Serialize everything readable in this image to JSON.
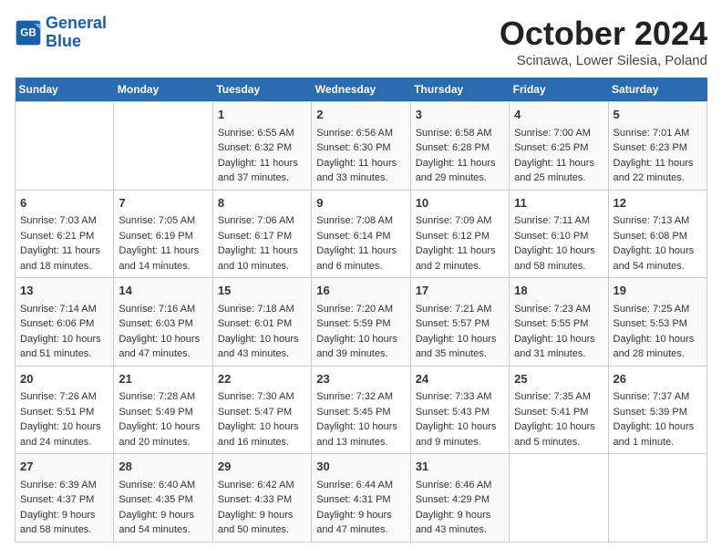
{
  "header": {
    "logo_line1": "General",
    "logo_line2": "Blue",
    "month": "October 2024",
    "location": "Scinawa, Lower Silesia, Poland"
  },
  "days_of_week": [
    "Sunday",
    "Monday",
    "Tuesday",
    "Wednesday",
    "Thursday",
    "Friday",
    "Saturday"
  ],
  "weeks": [
    [
      {
        "day": "",
        "info": ""
      },
      {
        "day": "",
        "info": ""
      },
      {
        "day": "1",
        "info": "Sunrise: 6:55 AM\nSunset: 6:32 PM\nDaylight: 11 hours and 37 minutes."
      },
      {
        "day": "2",
        "info": "Sunrise: 6:56 AM\nSunset: 6:30 PM\nDaylight: 11 hours and 33 minutes."
      },
      {
        "day": "3",
        "info": "Sunrise: 6:58 AM\nSunset: 6:28 PM\nDaylight: 11 hours and 29 minutes."
      },
      {
        "day": "4",
        "info": "Sunrise: 7:00 AM\nSunset: 6:25 PM\nDaylight: 11 hours and 25 minutes."
      },
      {
        "day": "5",
        "info": "Sunrise: 7:01 AM\nSunset: 6:23 PM\nDaylight: 11 hours and 22 minutes."
      }
    ],
    [
      {
        "day": "6",
        "info": "Sunrise: 7:03 AM\nSunset: 6:21 PM\nDaylight: 11 hours and 18 minutes."
      },
      {
        "day": "7",
        "info": "Sunrise: 7:05 AM\nSunset: 6:19 PM\nDaylight: 11 hours and 14 minutes."
      },
      {
        "day": "8",
        "info": "Sunrise: 7:06 AM\nSunset: 6:17 PM\nDaylight: 11 hours and 10 minutes."
      },
      {
        "day": "9",
        "info": "Sunrise: 7:08 AM\nSunset: 6:14 PM\nDaylight: 11 hours and 6 minutes."
      },
      {
        "day": "10",
        "info": "Sunrise: 7:09 AM\nSunset: 6:12 PM\nDaylight: 11 hours and 2 minutes."
      },
      {
        "day": "11",
        "info": "Sunrise: 7:11 AM\nSunset: 6:10 PM\nDaylight: 10 hours and 58 minutes."
      },
      {
        "day": "12",
        "info": "Sunrise: 7:13 AM\nSunset: 6:08 PM\nDaylight: 10 hours and 54 minutes."
      }
    ],
    [
      {
        "day": "13",
        "info": "Sunrise: 7:14 AM\nSunset: 6:06 PM\nDaylight: 10 hours and 51 minutes."
      },
      {
        "day": "14",
        "info": "Sunrise: 7:16 AM\nSunset: 6:03 PM\nDaylight: 10 hours and 47 minutes."
      },
      {
        "day": "15",
        "info": "Sunrise: 7:18 AM\nSunset: 6:01 PM\nDaylight: 10 hours and 43 minutes."
      },
      {
        "day": "16",
        "info": "Sunrise: 7:20 AM\nSunset: 5:59 PM\nDaylight: 10 hours and 39 minutes."
      },
      {
        "day": "17",
        "info": "Sunrise: 7:21 AM\nSunset: 5:57 PM\nDaylight: 10 hours and 35 minutes."
      },
      {
        "day": "18",
        "info": "Sunrise: 7:23 AM\nSunset: 5:55 PM\nDaylight: 10 hours and 31 minutes."
      },
      {
        "day": "19",
        "info": "Sunrise: 7:25 AM\nSunset: 5:53 PM\nDaylight: 10 hours and 28 minutes."
      }
    ],
    [
      {
        "day": "20",
        "info": "Sunrise: 7:26 AM\nSunset: 5:51 PM\nDaylight: 10 hours and 24 minutes."
      },
      {
        "day": "21",
        "info": "Sunrise: 7:28 AM\nSunset: 5:49 PM\nDaylight: 10 hours and 20 minutes."
      },
      {
        "day": "22",
        "info": "Sunrise: 7:30 AM\nSunset: 5:47 PM\nDaylight: 10 hours and 16 minutes."
      },
      {
        "day": "23",
        "info": "Sunrise: 7:32 AM\nSunset: 5:45 PM\nDaylight: 10 hours and 13 minutes."
      },
      {
        "day": "24",
        "info": "Sunrise: 7:33 AM\nSunset: 5:43 PM\nDaylight: 10 hours and 9 minutes."
      },
      {
        "day": "25",
        "info": "Sunrise: 7:35 AM\nSunset: 5:41 PM\nDaylight: 10 hours and 5 minutes."
      },
      {
        "day": "26",
        "info": "Sunrise: 7:37 AM\nSunset: 5:39 PM\nDaylight: 10 hours and 1 minute."
      }
    ],
    [
      {
        "day": "27",
        "info": "Sunrise: 6:39 AM\nSunset: 4:37 PM\nDaylight: 9 hours and 58 minutes."
      },
      {
        "day": "28",
        "info": "Sunrise: 6:40 AM\nSunset: 4:35 PM\nDaylight: 9 hours and 54 minutes."
      },
      {
        "day": "29",
        "info": "Sunrise: 6:42 AM\nSunset: 4:33 PM\nDaylight: 9 hours and 50 minutes."
      },
      {
        "day": "30",
        "info": "Sunrise: 6:44 AM\nSunset: 4:31 PM\nDaylight: 9 hours and 47 minutes."
      },
      {
        "day": "31",
        "info": "Sunrise: 6:46 AM\nSunset: 4:29 PM\nDaylight: 9 hours and 43 minutes."
      },
      {
        "day": "",
        "info": ""
      },
      {
        "day": "",
        "info": ""
      }
    ]
  ]
}
